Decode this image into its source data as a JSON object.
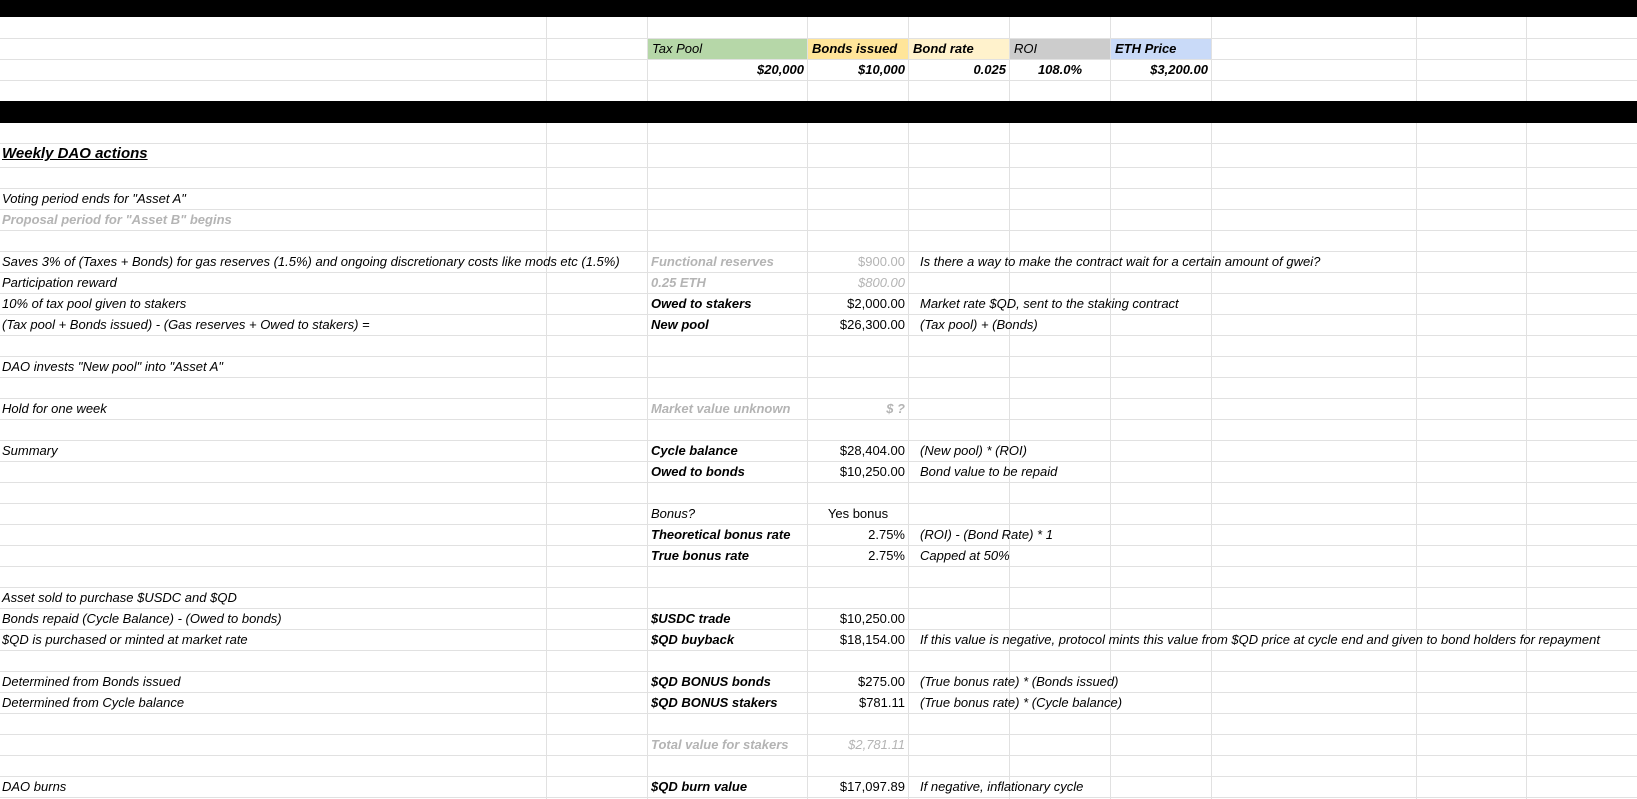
{
  "header": {
    "labels": {
      "tax_pool": "Tax Pool",
      "bonds_issued": "Bonds issued",
      "bond_rate": "Bond rate",
      "roi": "ROI",
      "eth_price": "ETH Price"
    },
    "values": {
      "tax_pool": "$20,000",
      "bonds_issued": "$10,000",
      "bond_rate": "0.025",
      "roi": "108.0%",
      "eth_price": "$3,200.00"
    },
    "colors": {
      "tax_pool": "#b6d7a8",
      "bonds_issued": "#ffe599",
      "bond_rate": "#fff2cc",
      "roi": "#cccccc",
      "eth_price": "#c9daf8"
    }
  },
  "title": "Weekly DAO actions",
  "rows": {
    "voting": "Voting period ends for \"Asset A\"",
    "proposal": "Proposal period for \"Asset B\" begins",
    "saves": {
      "desc": "Saves 3% of (Taxes + Bonds) for gas reserves (1.5%) and ongoing discretionary costs like mods etc (1.5%)",
      "label": "Functional reserves",
      "value": "$900.00",
      "note": "Is there a way to make the contract wait for a certain amount of gwei?"
    },
    "participation": {
      "desc": "Participation reward",
      "label": "0.25 ETH",
      "value": "$800.00"
    },
    "stakers": {
      "desc": "10% of tax pool given to stakers",
      "label": "Owed to stakers",
      "value": "$2,000.00",
      "note": "Market rate $QD, sent to the staking contract"
    },
    "new_pool": {
      "desc": "(Tax pool + Bonds issued) - (Gas reserves + Owed to stakers) =",
      "label": "New pool",
      "value": "$26,300.00",
      "note": "(Tax pool) + (Bonds)"
    },
    "invests": "DAO invests \"New pool\" into \"Asset A\"",
    "hold": {
      "desc": "Hold for one week",
      "label": "Market value unknown",
      "value": "$ ?"
    },
    "summary": {
      "desc": "Summary",
      "label": "Cycle balance",
      "value": "$28,404.00",
      "note": "(New pool) * (ROI)"
    },
    "owed_bonds": {
      "label": "Owed to bonds",
      "value": "$10,250.00",
      "note": "Bond value to be repaid"
    },
    "bonus": {
      "label": "Bonus?",
      "value": "Yes bonus"
    },
    "theoretical": {
      "label": "Theoretical bonus rate",
      "value": "2.75%",
      "note": "(ROI) - (Bond Rate) * 1"
    },
    "true_rate": {
      "label": "True bonus rate",
      "value": "2.75%",
      "note": "Capped at 50%"
    },
    "asset_sold": "Asset sold to purchase $USDC and $QD",
    "usdc": {
      "desc": "Bonds repaid (Cycle Balance) - (Owed to bonds)",
      "label": "$USDC trade",
      "value": "$10,250.00"
    },
    "buyback": {
      "desc": "$QD is purchased or minted at market rate",
      "label": "$QD buyback",
      "value": "$18,154.00",
      "note": "If this value is negative, protocol mints this value from $QD price at cycle end and given to bond holders for repayment"
    },
    "bonus_bonds": {
      "desc": "Determined from Bonds issued",
      "label": "$QD BONUS bonds",
      "value": "$275.00",
      "note": "(True bonus rate) * (Bonds issued)"
    },
    "bonus_stakers": {
      "desc": "Determined from Cycle balance",
      "label": "$QD BONUS stakers",
      "value": "$781.11",
      "note": "(True bonus rate) * (Cycle balance)"
    },
    "total_stakers": {
      "label": "Total value for stakers",
      "value": "$2,781.11"
    },
    "burns": {
      "desc": "DAO burns",
      "label": "$QD burn value",
      "value": "$17,097.89",
      "note": "If negative, inflationary cycle"
    }
  }
}
